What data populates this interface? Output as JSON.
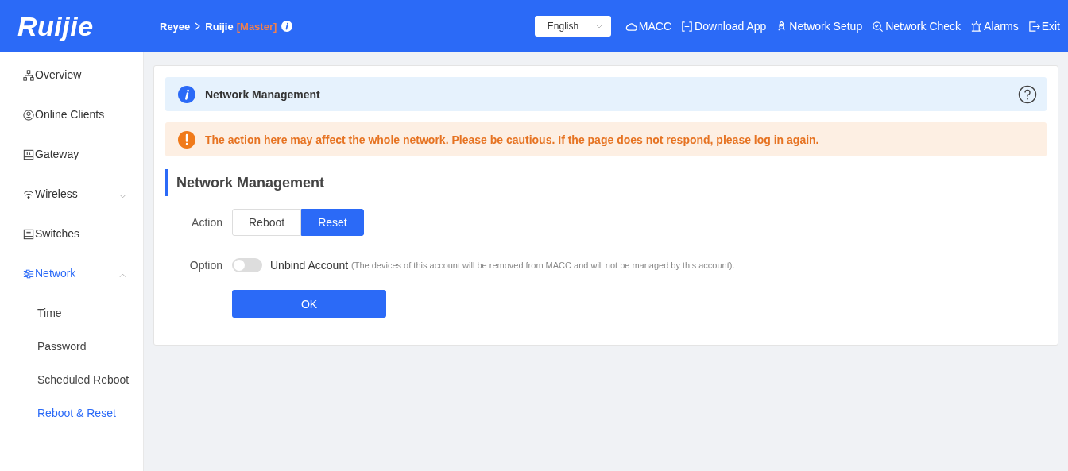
{
  "header": {
    "logo": "Ruijie",
    "breadcrumb": [
      {
        "label": "Reyee"
      },
      {
        "label": "Ruijie"
      }
    ],
    "role_tag": "[Master]",
    "language": "English",
    "actions": [
      {
        "kind": "cloud",
        "label": "MACC"
      },
      {
        "kind": "download",
        "label": "Download App"
      },
      {
        "kind": "rocket",
        "label": "Network Setup"
      },
      {
        "kind": "check",
        "label": "Network Check"
      },
      {
        "kind": "alarm",
        "label": "Alarms"
      },
      {
        "kind": "exit",
        "label": "Exit"
      }
    ]
  },
  "sidebar": {
    "items": [
      {
        "kind": "overview",
        "label": "Overview",
        "selected": false
      },
      {
        "kind": "clients",
        "label": "Online Clients",
        "selected": false
      },
      {
        "kind": "gateway",
        "label": "Gateway",
        "selected": false
      },
      {
        "kind": "wireless",
        "label": "Wireless",
        "selected": false,
        "expanded": false
      },
      {
        "kind": "switches",
        "label": "Switches",
        "selected": false
      },
      {
        "kind": "network",
        "label": "Network",
        "selected": true,
        "expanded": true,
        "children": [
          {
            "label": "Time",
            "selected": false
          },
          {
            "label": "Password",
            "selected": false
          },
          {
            "label": "Scheduled Reboot",
            "selected": false
          },
          {
            "label": "Reboot & Reset",
            "selected": true
          }
        ]
      }
    ]
  },
  "info_bar": {
    "title": "Network Management"
  },
  "warning": "The action here may affect the whole network. Please be cautious. If the page does not respond, please log in again.",
  "section_title": "Network Management",
  "form": {
    "action_label": "Action",
    "actions": [
      {
        "label": "Reboot",
        "selected": false
      },
      {
        "label": "Reset",
        "selected": true
      }
    ],
    "option_label": "Option",
    "option": {
      "on": false,
      "label": "Unbind Account",
      "note": "(The devices of this account will be removed from MACC and will not be managed by this account)."
    },
    "submit": "OK"
  }
}
